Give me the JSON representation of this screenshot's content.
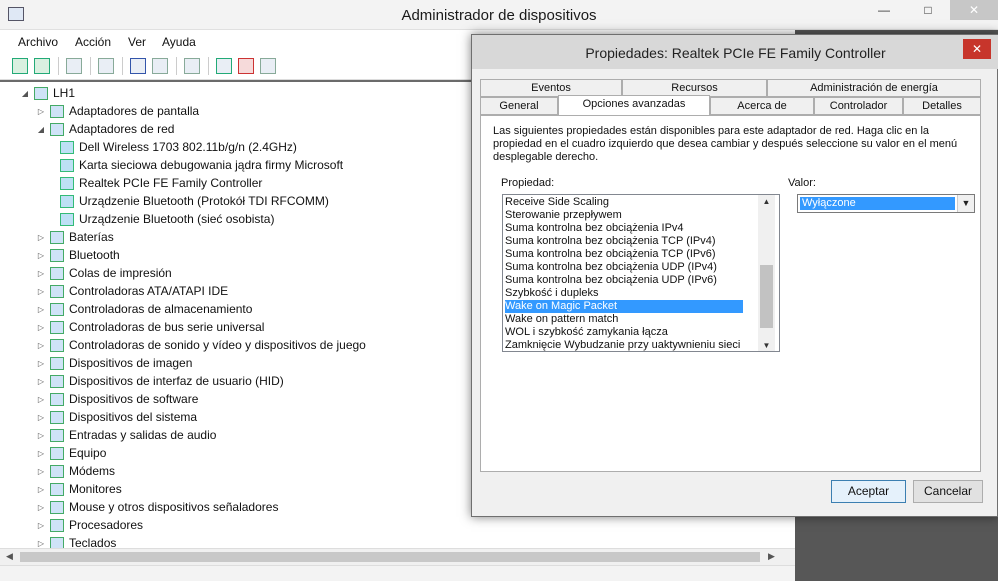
{
  "main_window": {
    "title": "Administrador de dispositivos",
    "minimize": "—",
    "maximize": "□",
    "close": "✕"
  },
  "menu": [
    "Archivo",
    "Acción",
    "Ver",
    "Ayuda"
  ],
  "tree": {
    "root": "LH1",
    "items": [
      {
        "label": "Adaptadores de pantalla",
        "level": 1,
        "expanded": false
      },
      {
        "label": "Adaptadores de red",
        "level": 1,
        "expanded": true
      },
      {
        "label": "Dell Wireless 1703 802.11b/g/n (2.4GHz)",
        "level": 2
      },
      {
        "label": "Karta sieciowa debugowania jądra firmy Microsoft",
        "level": 2
      },
      {
        "label": "Realtek PCIe FE Family Controller",
        "level": 2
      },
      {
        "label": "Urządzenie Bluetooth (Protokół TDI RFCOMM)",
        "level": 2
      },
      {
        "label": "Urządzenie Bluetooth (sieć osobista)",
        "level": 2
      },
      {
        "label": "Baterías",
        "level": 1,
        "expanded": false
      },
      {
        "label": "Bluetooth",
        "level": 1,
        "expanded": false
      },
      {
        "label": "Colas de impresión",
        "level": 1,
        "expanded": false
      },
      {
        "label": "Controladoras ATA/ATAPI IDE",
        "level": 1,
        "expanded": false
      },
      {
        "label": "Controladoras de almacenamiento",
        "level": 1,
        "expanded": false
      },
      {
        "label": "Controladoras de bus serie universal",
        "level": 1,
        "expanded": false
      },
      {
        "label": "Controladoras de sonido y vídeo y dispositivos de juego",
        "level": 1,
        "expanded": false
      },
      {
        "label": "Dispositivos de imagen",
        "level": 1,
        "expanded": false
      },
      {
        "label": "Dispositivos de interfaz de usuario (HID)",
        "level": 1,
        "expanded": false
      },
      {
        "label": "Dispositivos de software",
        "level": 1,
        "expanded": false
      },
      {
        "label": "Dispositivos del sistema",
        "level": 1,
        "expanded": false
      },
      {
        "label": "Entradas y salidas de audio",
        "level": 1,
        "expanded": false
      },
      {
        "label": "Equipo",
        "level": 1,
        "expanded": false
      },
      {
        "label": "Módems",
        "level": 1,
        "expanded": false
      },
      {
        "label": "Monitores",
        "level": 1,
        "expanded": false
      },
      {
        "label": "Mouse y otros dispositivos señaladores",
        "level": 1,
        "expanded": false
      },
      {
        "label": "Procesadores",
        "level": 1,
        "expanded": false
      },
      {
        "label": "Teclados",
        "level": 1,
        "expanded": false
      }
    ]
  },
  "dialog": {
    "title": "Propiedades: Realtek PCIe FE Family Controller",
    "close": "✕",
    "tabs_back": [
      "Eventos",
      "Recursos",
      "Administración de energía"
    ],
    "tabs_front": [
      "General",
      "Opciones avanzadas",
      "Acerca de",
      "Controlador",
      "Detalles"
    ],
    "active_tab": "Opciones avanzadas",
    "description": "Las siguientes propiedades están disponibles para este adaptador de red. Haga clic en la propiedad en el cuadro izquierdo que desea cambiar y después seleccione su valor en el menú desplegable derecho.",
    "property_label": "Propiedad:",
    "value_label": "Valor:",
    "properties": [
      "Receive Side Scaling",
      "Sterowanie przepływem",
      "Suma kontrolna bez obciążenia IPv4",
      "Suma kontrolna bez obciążenia TCP (IPv4)",
      "Suma kontrolna bez obciążenia TCP (IPv6)",
      "Suma kontrolna bez obciążenia UDP (IPv4)",
      "Suma kontrolna bez obciążenia UDP (IPv6)",
      "Szybkość i dupleks",
      "Wake on Magic Packet",
      "Wake on pattern match",
      "WOL i szybkość zamykania łącza",
      "Zamknięcie Wybudzanie przy uaktywnieniu sieci"
    ],
    "selected_property": "Wake on Magic Packet",
    "value": "Wyłączone",
    "ok": "Aceptar",
    "cancel": "Cancelar"
  }
}
